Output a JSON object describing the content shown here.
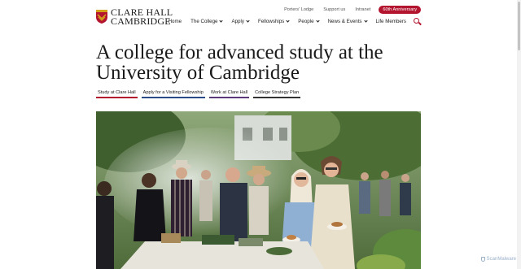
{
  "header": {
    "logo_line1": "CLARE HALL",
    "logo_line2": "CAMBRIDGE",
    "utility_links": [
      "Porters' Lodge",
      "Support us",
      "Intranet"
    ],
    "anniversary_label": "60th Anniversary",
    "nav": [
      {
        "label": "Home",
        "dropdown": false
      },
      {
        "label": "The College",
        "dropdown": true
      },
      {
        "label": "Apply",
        "dropdown": true
      },
      {
        "label": "Fellowships",
        "dropdown": true
      },
      {
        "label": "People",
        "dropdown": true
      },
      {
        "label": "News & Events",
        "dropdown": true
      },
      {
        "label": "Life Members",
        "dropdown": false
      }
    ]
  },
  "hero": {
    "headline": "A college for advanced study at the University of Cambridge",
    "buttons": [
      {
        "label": "Study at Clare Hall",
        "accent": "#b3142e"
      },
      {
        "label": "Apply for a Visiting Fellowship",
        "accent": "#2b4a8a"
      },
      {
        "label": "Work at Clare Hall",
        "accent": "#5a3a7a"
      },
      {
        "label": "College Strategy Plan",
        "accent": "#333333"
      }
    ]
  },
  "watermark": "ScanMalware",
  "colors": {
    "brand_red": "#b3142e",
    "text": "#1a1a1a"
  }
}
